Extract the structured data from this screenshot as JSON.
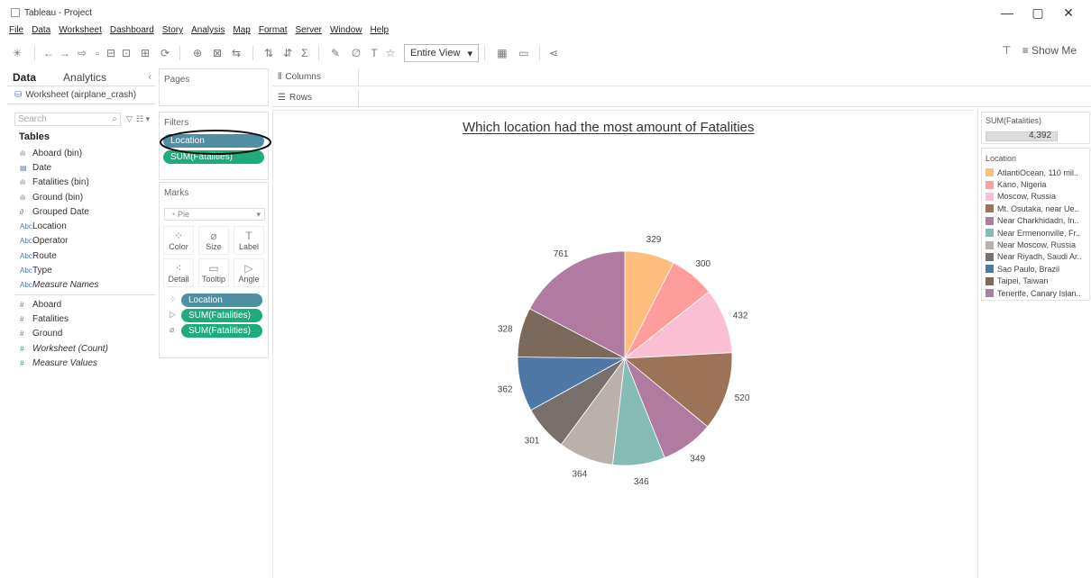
{
  "window": {
    "title": "Tableau - Project",
    "minimize": "—",
    "maximize": "▢",
    "close": "✕"
  },
  "menu": [
    "File",
    "Data",
    "Worksheet",
    "Dashboard",
    "Story",
    "Analysis",
    "Map",
    "Format",
    "Server",
    "Window",
    "Help"
  ],
  "toolbar": {
    "fit": "Entire View",
    "show_me": "Show Me"
  },
  "data_pane": {
    "tab_data": "Data",
    "tab_analytics": "Analytics",
    "datasource": "Worksheet (airplane_crash)",
    "search_placeholder": "Search",
    "tables_heading": "Tables",
    "dimensions": [
      {
        "icon": "bin-icon",
        "glyph": "ılı",
        "label": "Aboard (bin)"
      },
      {
        "icon": "calendar-icon",
        "glyph": "▤",
        "label": "Date"
      },
      {
        "icon": "bin-icon",
        "glyph": "ılı",
        "label": "Fatalities (bin)"
      },
      {
        "icon": "bin-icon",
        "glyph": "ılı",
        "label": "Ground (bin)"
      },
      {
        "icon": "link-icon",
        "glyph": "∂",
        "label": "Grouped Date"
      },
      {
        "icon": "string-icon",
        "glyph": "Abc",
        "label": "Location"
      },
      {
        "icon": "string-icon",
        "glyph": "Abc",
        "label": "Operator"
      },
      {
        "icon": "string-icon",
        "glyph": "Abc",
        "label": "Route"
      },
      {
        "icon": "string-icon",
        "glyph": "Abc",
        "label": "Type"
      },
      {
        "icon": "string-icon",
        "glyph": "Abc",
        "label": "Measure Names",
        "italic": true
      }
    ],
    "measures": [
      {
        "label": "Aboard"
      },
      {
        "label": "Fatalities"
      },
      {
        "label": "Ground"
      },
      {
        "label": "Worksheet (Count)",
        "italic": true
      },
      {
        "label": "Measure Values",
        "italic": true
      }
    ]
  },
  "shelves": {
    "pages": "Pages",
    "filters": "Filters",
    "filter_pills": [
      "Location",
      "SUM(Fatalities)"
    ],
    "marks": "Marks",
    "mark_type": "Pie",
    "mark_buttons": [
      "Color",
      "Size",
      "Label",
      "Detail",
      "Tooltip",
      "Angle"
    ],
    "mark_pills": [
      "Location",
      "SUM(Fatalities)",
      "SUM(Fatalities)"
    ],
    "columns": "Columns",
    "rows": "Rows"
  },
  "legend": {
    "size_title": "SUM(Fatalities)",
    "size_value": "4,392",
    "color_title": "Location"
  },
  "chart_data": {
    "type": "pie",
    "title": "Which location had the most amount of Fatalities",
    "slices": [
      {
        "label": "AtlantiOcean, 110 mil..",
        "value": 329,
        "color": "#ffbe7d"
      },
      {
        "label": "Kano, Nigeria",
        "value": 300,
        "color": "#ff9d9a"
      },
      {
        "label": "Moscow, Russia",
        "value": 432,
        "color": "#fabfd2"
      },
      {
        "label": "Mt. Osutaka, near Ue..",
        "value": 520,
        "color": "#9c7358"
      },
      {
        "label": "Near Charkhidadri, In..",
        "value": 349,
        "color": "#b07aa1"
      },
      {
        "label": "Near Ermenonville, Fr..",
        "value": 346,
        "color": "#86bcb6"
      },
      {
        "label": "Near Moscow, Russia",
        "value": 364,
        "color": "#bab0ac"
      },
      {
        "label": "Near Riyadh, Saudi Ar..",
        "value": 301,
        "color": "#79706e"
      },
      {
        "label": "Sao Paulo, Brazil",
        "value": 362,
        "color": "#4e79a7"
      },
      {
        "label": "Taipei, Taiwan",
        "value": 328,
        "color": "#7b6a5c"
      },
      {
        "label": "Tenerife, Canary Islan..",
        "value": 761,
        "color": "#b07aa1"
      }
    ]
  }
}
